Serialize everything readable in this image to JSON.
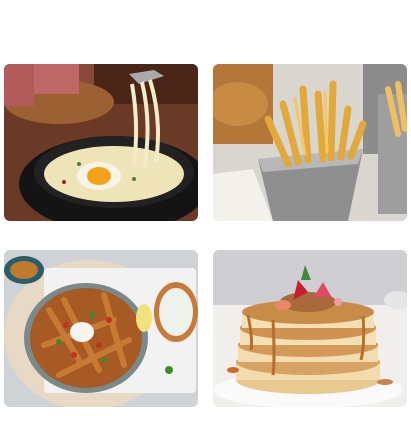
{
  "gallery": {
    "images": [
      {
        "icon": "cheese-skillet-egg-image"
      },
      {
        "icon": "french-fries-cups-image"
      },
      {
        "icon": "loaded-fries-board-image"
      },
      {
        "icon": "pancake-stack-image"
      }
    ]
  },
  "colors": {
    "background": "#ffffff",
    "tile_placeholder": "#dddddd"
  }
}
